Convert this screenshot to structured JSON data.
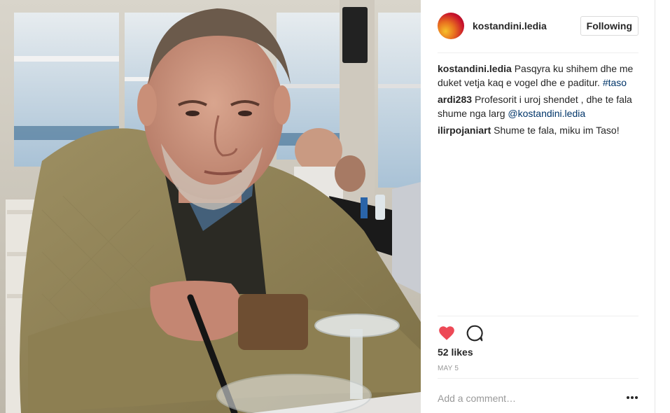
{
  "post": {
    "username": "kostandini.ledia",
    "follow_label": "Following",
    "photo_alt": ""
  },
  "comments": [
    {
      "user": "kostandini.ledia",
      "text": "Pasqyra ku shihem dhe me duket vetja kaq e vogel dhe e paditur. ",
      "link": "#taso"
    },
    {
      "user": "ardi283",
      "text": "Profesorit i uroj shendet , dhe te fala shume nga larg ",
      "link": "@kostandini.ledia"
    },
    {
      "user": "ilirpojaniart",
      "text": "Shume te fala, miku im Taso!",
      "link": ""
    }
  ],
  "stats": {
    "likes": "52 likes",
    "date": "MAY 5"
  },
  "comment_box": {
    "placeholder": "Add a comment…"
  },
  "icons": {
    "like": "heart-icon",
    "comment": "comment-bubble-icon",
    "more": "more-options-icon",
    "like_color": "#ed4956"
  }
}
